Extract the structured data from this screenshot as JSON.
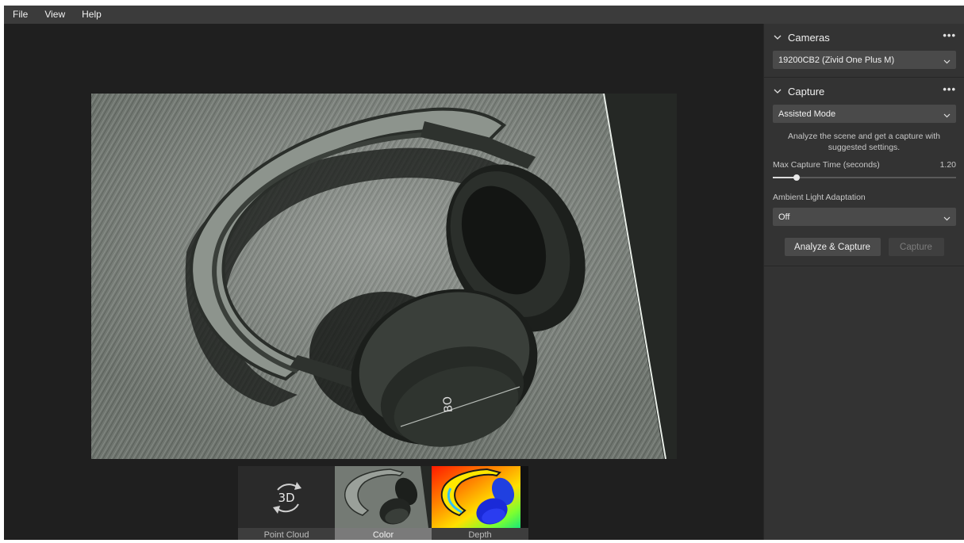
{
  "menu": [
    "File",
    "View",
    "Help"
  ],
  "thumbnails": [
    {
      "id": "pc",
      "label": "Point Cloud",
      "icon_text": "3D",
      "icon": "rotate-3d-icon",
      "selected": false
    },
    {
      "id": "color",
      "label": "Color",
      "icon": "color-image-thumbnail",
      "selected": true
    },
    {
      "id": "depth",
      "label": "Depth",
      "icon": "depth-image-thumbnail",
      "selected": false
    }
  ],
  "panel": {
    "cameras": {
      "title": "Cameras",
      "more": "•••",
      "selected_camera": "19200CB2 (Zivid One Plus M)"
    },
    "capture": {
      "title": "Capture",
      "more": "•••",
      "mode": "Assisted Mode",
      "hint_line1": "Analyze the scene and get a capture with",
      "hint_line2": "suggested settings.",
      "max_time_label": "Max Capture Time (seconds)",
      "max_time_value": "1.20",
      "max_time_fraction": 0.13,
      "ambient_label": "Ambient Light Adaptation",
      "ambient_value": "Off",
      "analyze_button": "Analyze & Capture",
      "capture_button": "Capture"
    }
  },
  "colors": {
    "panel_bg": "#333333",
    "viewport_bg": "#1f1f1f",
    "menubar_bg": "#3b3b3b",
    "selected_thumb_label": "#7a7a7a"
  }
}
